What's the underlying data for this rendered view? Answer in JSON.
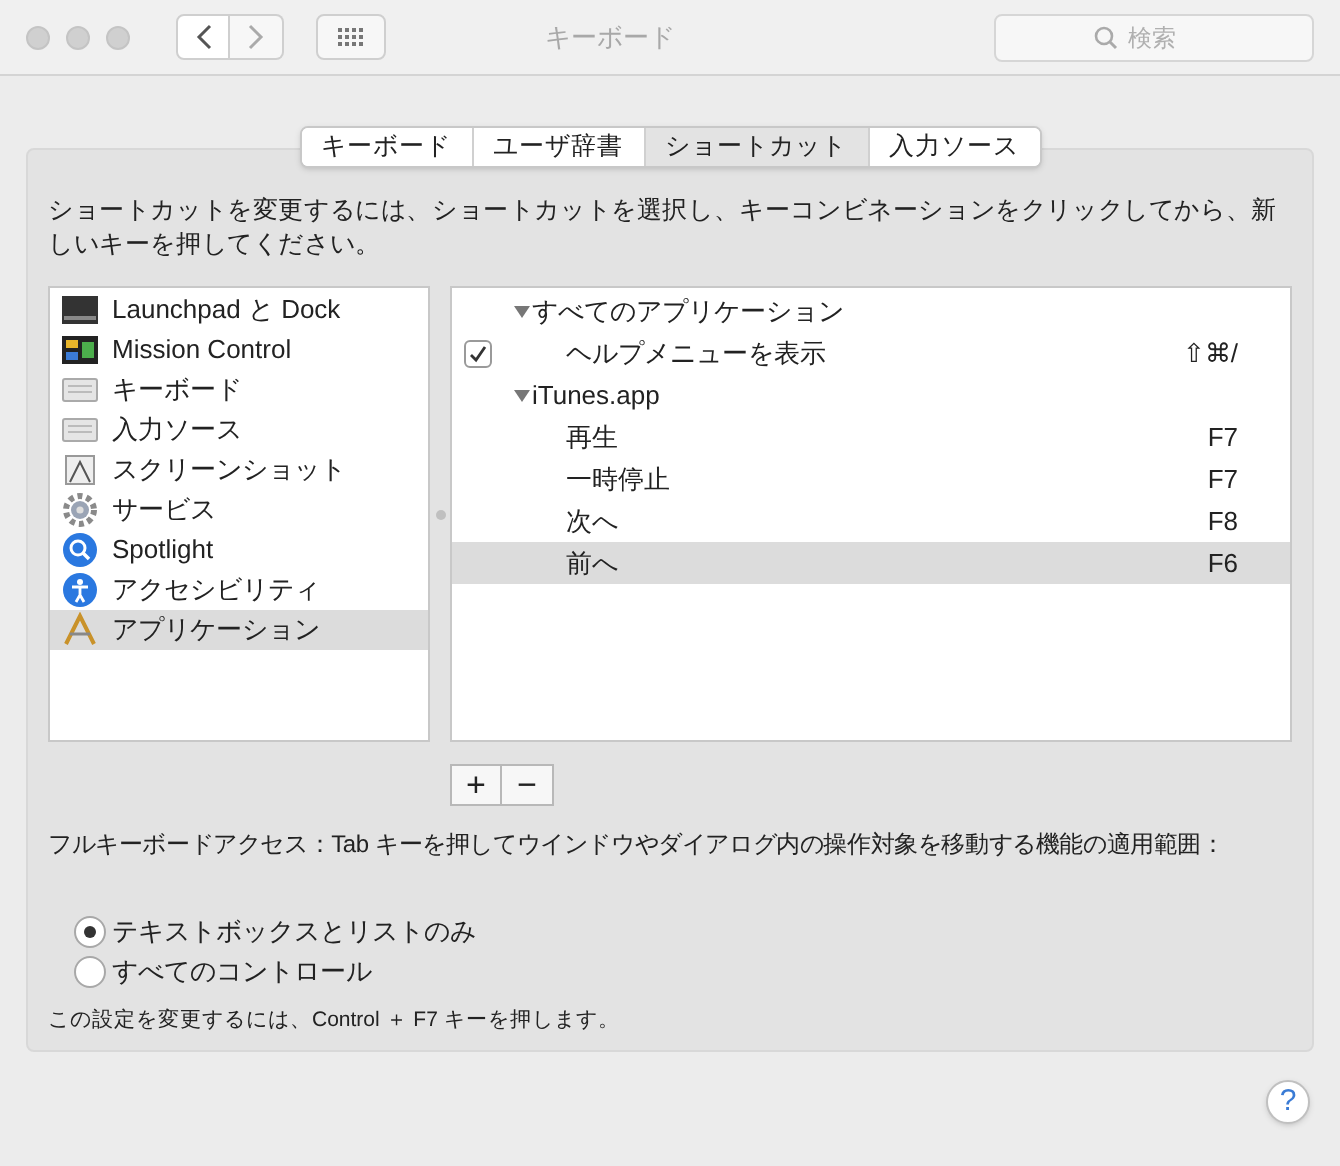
{
  "window": {
    "title": "キーボード"
  },
  "search": {
    "placeholder": "検索"
  },
  "tabs": [
    {
      "label": "キーボード",
      "selected": false
    },
    {
      "label": "ユーザ辞書",
      "selected": false
    },
    {
      "label": "ショートカット",
      "selected": true
    },
    {
      "label": "入力ソース",
      "selected": false
    }
  ],
  "instructions": "ショートカットを変更するには、ショートカットを選択し、キーコンビネーションをクリックしてから、新しいキーを押してください。",
  "categories": [
    {
      "label": "Launchpad と Dock",
      "selected": false
    },
    {
      "label": "Mission Control",
      "selected": false
    },
    {
      "label": "キーボード",
      "selected": false
    },
    {
      "label": "入力ソース",
      "selected": false
    },
    {
      "label": "スクリーンショット",
      "selected": false
    },
    {
      "label": "サービス",
      "selected": false
    },
    {
      "label": "Spotlight",
      "selected": false
    },
    {
      "label": "アクセシビリティ",
      "selected": false
    },
    {
      "label": "アプリケーション",
      "selected": true
    }
  ],
  "shortcuts": [
    {
      "label": "すべてのアプリケーション",
      "expanded": true,
      "selected": false,
      "children": [
        {
          "kind": "checkbox",
          "label": "ヘルプメニューを表示",
          "keys": "⇧⌘/",
          "checked": true,
          "selected": false
        }
      ]
    },
    {
      "label": "iTunes.app",
      "expanded": true,
      "selected": false,
      "children": [
        {
          "kind": "plain",
          "label": "再生",
          "keys": "F7",
          "selected": false
        },
        {
          "kind": "plain",
          "label": "一時停止",
          "keys": "F7",
          "selected": false
        },
        {
          "kind": "plain",
          "label": "次へ",
          "keys": "F8",
          "selected": false
        },
        {
          "kind": "plain",
          "label": "前へ",
          "keys": "F6",
          "selected": true
        }
      ]
    }
  ],
  "add_remove": [
    "+",
    "−"
  ],
  "full_keyboard_access": {
    "label": "フルキーボードアクセス：Tab キーを押してウインドウやダイアログ内の操作対象を移動する機能の適用範囲：",
    "options": [
      {
        "label": "テキストボックスとリストのみ",
        "selected": true
      },
      {
        "label": "すべてのコントロール",
        "selected": false
      }
    ],
    "note": "この設定を変更するには、Control ＋ F7 キーを押します。"
  },
  "help": "?"
}
